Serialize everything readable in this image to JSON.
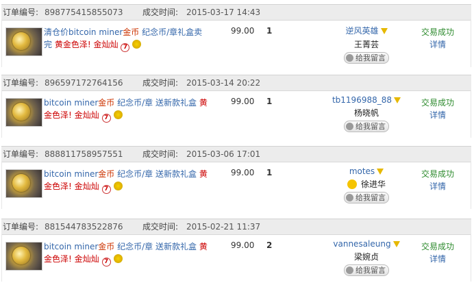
{
  "labels": {
    "order_no": "订单编号:",
    "deal_time": "成交时间:",
    "leave_msg": "给我留言",
    "seven_icon": "7"
  },
  "orders": [
    {
      "order_no": "898775415855073",
      "time": "2015-03-17 14:43",
      "title_pre": "清仓价bitcoin miner",
      "title_hi": "金币",
      "title_post": " 纪念币/章礼盒卖完 ",
      "title_red": "黄金色泽!",
      "title_tail": " ",
      "title_red2": "金灿灿",
      "price": "99.00",
      "qty": "1",
      "buyer_nick": "逆风英雄",
      "buyer_name": "王菁芸",
      "status": "交易成功",
      "detail": "详情"
    },
    {
      "order_no": "896597172764156",
      "time": "2015-03-14 20:22",
      "title_pre": "bitcoin miner",
      "title_hi": "金币",
      "title_post": " 纪念币/章 送新款礼盒 ",
      "title_red": "黄金色泽!",
      "title_tail": " ",
      "title_red2": "金灿灿",
      "price": "99.00",
      "qty": "1",
      "buyer_nick": "tb1196988_88",
      "buyer_name": "杨晓帆",
      "status": "交易成功",
      "detail": "详情"
    },
    {
      "order_no": "888811758957551",
      "time": "2015-03-06 17:01",
      "title_pre": "bitcoin miner",
      "title_hi": "金币",
      "title_post": " 纪念币/章 送新款礼盒 ",
      "title_red": "黄金色泽!",
      "title_tail": " ",
      "title_red2": "金灿灿",
      "price": "99.00",
      "qty": "1",
      "buyer_nick": "motes",
      "buyer_name": "徐进华",
      "status": "交易成功",
      "detail": "详情"
    },
    {
      "order_no": "881544783522876",
      "time": "2015-02-21 11:37",
      "title_pre": "bitcoin miner",
      "title_hi": "金币",
      "title_post": " 纪念币/章 送新款礼盒 ",
      "title_red": "黄金色泽!",
      "title_tail": " ",
      "title_red2": "金灿灿",
      "price": "99.00",
      "qty": "2",
      "buyer_nick": "vannesaleung",
      "buyer_name": "梁婉贞",
      "status": "交易成功",
      "detail": "详情"
    }
  ]
}
